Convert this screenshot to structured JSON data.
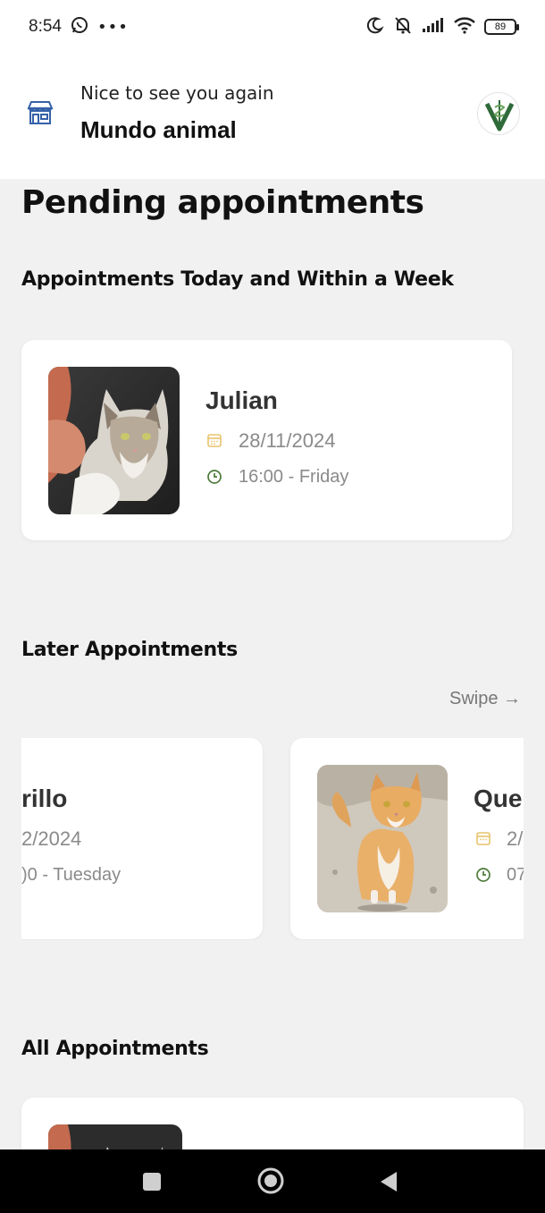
{
  "status_bar": {
    "time": "8:54",
    "icons": [
      "whatsapp-icon",
      "more-dots-icon",
      "moon-icon",
      "mute-icon",
      "signal-icon",
      "wifi-icon"
    ],
    "battery": "89"
  },
  "header": {
    "greeting": "Nice to see you again",
    "vet_name": "Mundo animal",
    "store_icon": "store-icon",
    "logo": "vet-logo"
  },
  "page": {
    "title": "Pending appointments"
  },
  "sections": {
    "today_week": {
      "title": "Appointments Today and Within a Week",
      "cards": [
        {
          "pet": "Julian",
          "date": "28/11/2024",
          "time": "16:00 - Friday"
        }
      ]
    },
    "later": {
      "title": "Later Appointments",
      "swipe_label": "Swipe →",
      "cards": [
        {
          "pet": "rillo",
          "date": "2/2024",
          "time": ")0 - Tuesday"
        },
        {
          "pet": "Que",
          "date": "2/",
          "time": "07"
        }
      ]
    },
    "all": {
      "title": "All Appointments"
    }
  },
  "colors": {
    "calendar_icon": "#e8c36a",
    "clock_icon": "#4d7a3a",
    "accent_green": "#2f6b3a"
  },
  "nav_bar": {
    "buttons": [
      "recent-apps-button",
      "home-button",
      "back-button"
    ]
  }
}
